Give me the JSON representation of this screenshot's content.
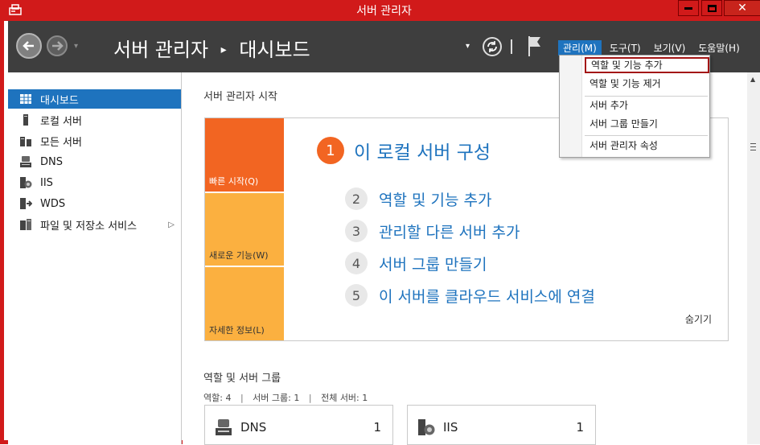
{
  "window": {
    "title": "서버 관리자",
    "close_glyph": "✕"
  },
  "header": {
    "breadcrumb_root": "서버 관리자",
    "breadcrumb_sep": "▸",
    "breadcrumb_current": "대시보드",
    "dropdown_glyph": "▾",
    "menus": [
      {
        "label": "관리(M)"
      },
      {
        "label": "도구(T)"
      },
      {
        "label": "보기(V)"
      },
      {
        "label": "도움말(H)"
      }
    ]
  },
  "manage_menu": {
    "items": [
      {
        "label": "역할 및 기능 추가"
      },
      {
        "label": "역할 및 기능 제거"
      },
      {
        "label": "서버 추가"
      },
      {
        "label": "서버 그룹 만들기"
      },
      {
        "label": "서버 관리자 속성"
      }
    ]
  },
  "sidebar": {
    "items": [
      {
        "label": "대시보드",
        "icon": "dashboard-icon",
        "selected": true
      },
      {
        "label": "로컬 서버",
        "icon": "server-icon"
      },
      {
        "label": "모든 서버",
        "icon": "servers-icon"
      },
      {
        "label": "DNS",
        "icon": "dns-icon"
      },
      {
        "label": "IIS",
        "icon": "iis-icon"
      },
      {
        "label": "WDS",
        "icon": "wds-icon"
      },
      {
        "label": "파일 및 저장소 서비스",
        "icon": "file-storage-icon",
        "has_arrow": true
      }
    ],
    "expand_glyph": "▷"
  },
  "main": {
    "welcome_title": "서버 관리자 시작",
    "tiles": {
      "quick_start": "빠른 시작(Q)",
      "whats_new": "새로운 기능(W)",
      "learn_more": "자세한 정보(L)"
    },
    "steps": [
      {
        "num": "1",
        "text": "이 로컬 서버 구성"
      },
      {
        "num": "2",
        "text": "역할 및 기능 추가"
      },
      {
        "num": "3",
        "text": "관리할 다른 서버 추가"
      },
      {
        "num": "4",
        "text": "서버 그룹 만들기"
      },
      {
        "num": "5",
        "text": "이 서버를 클라우드 서비스에 연결"
      }
    ],
    "hide_label": "숨기기",
    "roles_title": "역할 및 서버 그룹",
    "roles_summary": {
      "roles": "역할: 4",
      "groups": "서버 그룹: 1",
      "total": "전체 서버: 1",
      "divider": "|"
    },
    "cards": [
      {
        "name": "DNS",
        "count": "1"
      },
      {
        "name": "IIS",
        "count": "1"
      }
    ]
  },
  "colors": {
    "title_bar": "#d11a1a",
    "header_bg": "#3e3e3e",
    "accent_blue": "#1e73be",
    "quick_start_orange": "#f26522",
    "tile_yellow": "#fbb040",
    "highlight_border": "#a31515"
  }
}
